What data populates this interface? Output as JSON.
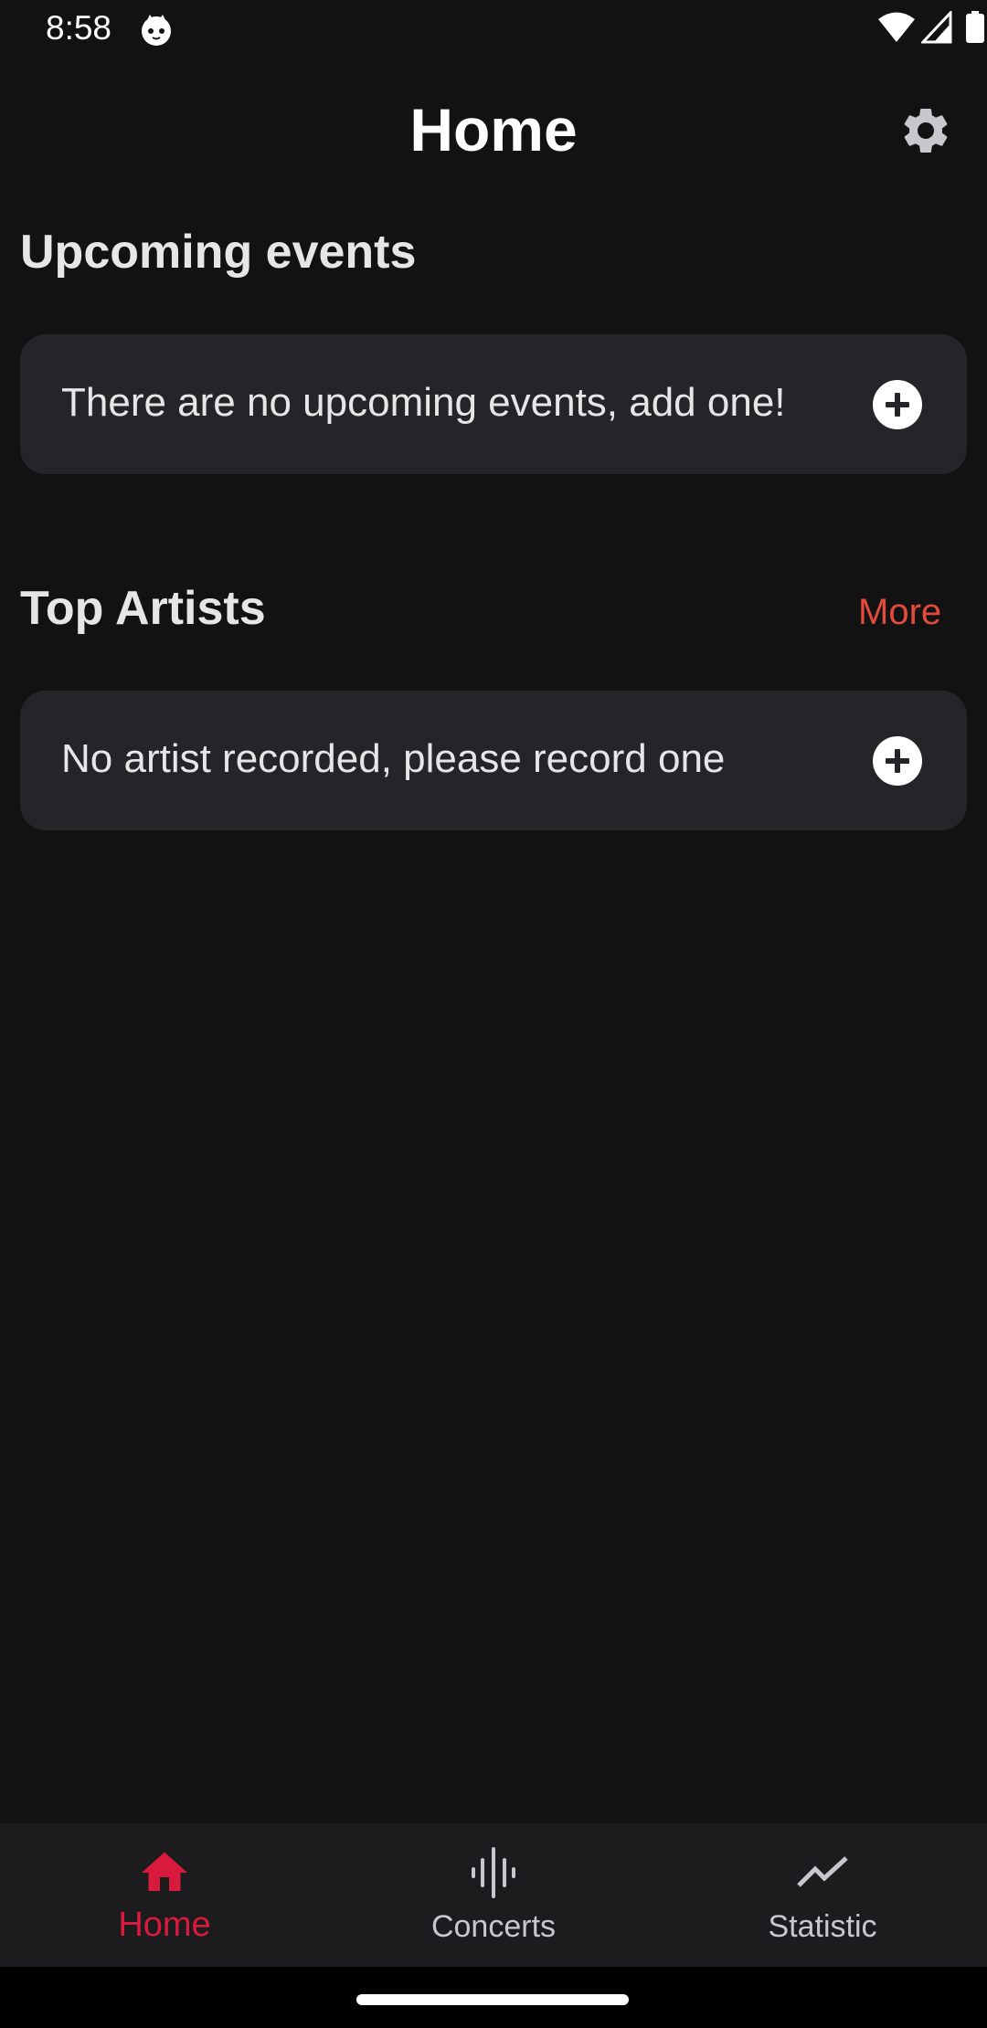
{
  "status_bar": {
    "time": "8:58",
    "icons": [
      "cat-notification-icon",
      "wifi-icon",
      "cell-signal-icon",
      "battery-icon"
    ]
  },
  "header": {
    "title": "Home",
    "settings_icon": "gear-icon"
  },
  "upcoming": {
    "title": "Upcoming events",
    "empty_message": "There are no upcoming events, add one!",
    "add_icon": "add-circle-icon"
  },
  "top_artists": {
    "title": "Top Artists",
    "more_label": "More",
    "empty_message": "No artist recorded, please record one",
    "add_icon": "add-circle-icon"
  },
  "bottom_nav": {
    "items": [
      {
        "label": "Home",
        "icon": "home-icon",
        "active": true
      },
      {
        "label": "Concerts",
        "icon": "sound-wave-icon",
        "active": false
      },
      {
        "label": "Statistic",
        "icon": "trend-line-icon",
        "active": false
      }
    ]
  },
  "colors": {
    "background": "#121213",
    "card": "#252429",
    "accent_more": "#e24a3b",
    "nav_active": "#d81b3c",
    "nav_inactive": "#c9c7cd"
  }
}
